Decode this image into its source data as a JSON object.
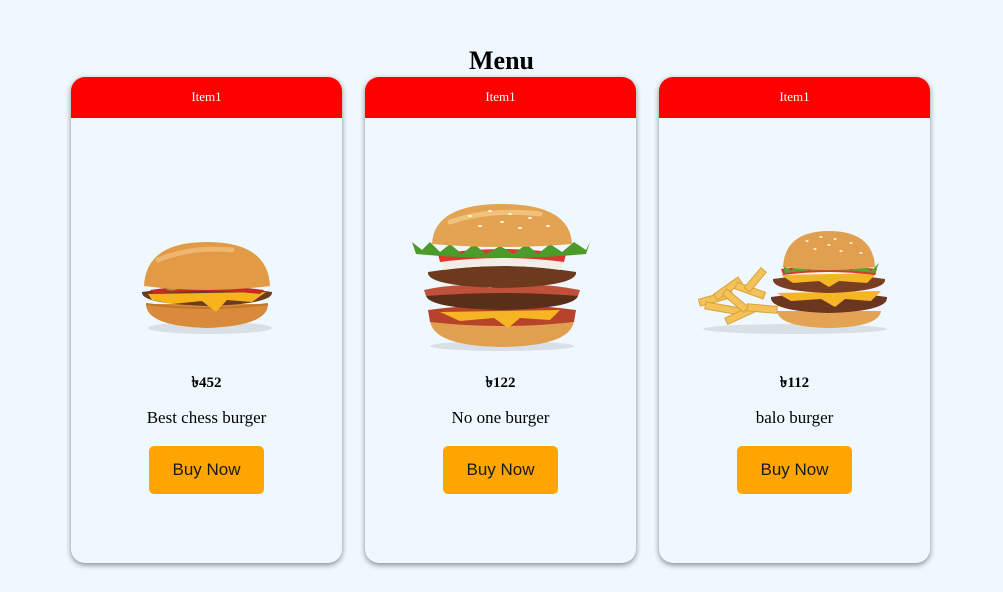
{
  "page": {
    "title": "Menu",
    "background_color": "#f0f8ff"
  },
  "colors": {
    "header": "#ff0000",
    "button": "#ffa500"
  },
  "cards": [
    {
      "header": "Item1",
      "image": "cheeseburger-image",
      "price": "৳452",
      "description": "Best chess burger",
      "button_label": "Buy Now"
    },
    {
      "header": "Item1",
      "image": "triple-stack-burger-image",
      "price": "৳122",
      "description": "No one burger",
      "button_label": "Buy Now"
    },
    {
      "header": "Item1",
      "image": "burger-and-fries-image",
      "price": "৳112",
      "description": "balo burger",
      "button_label": "Buy Now"
    }
  ]
}
